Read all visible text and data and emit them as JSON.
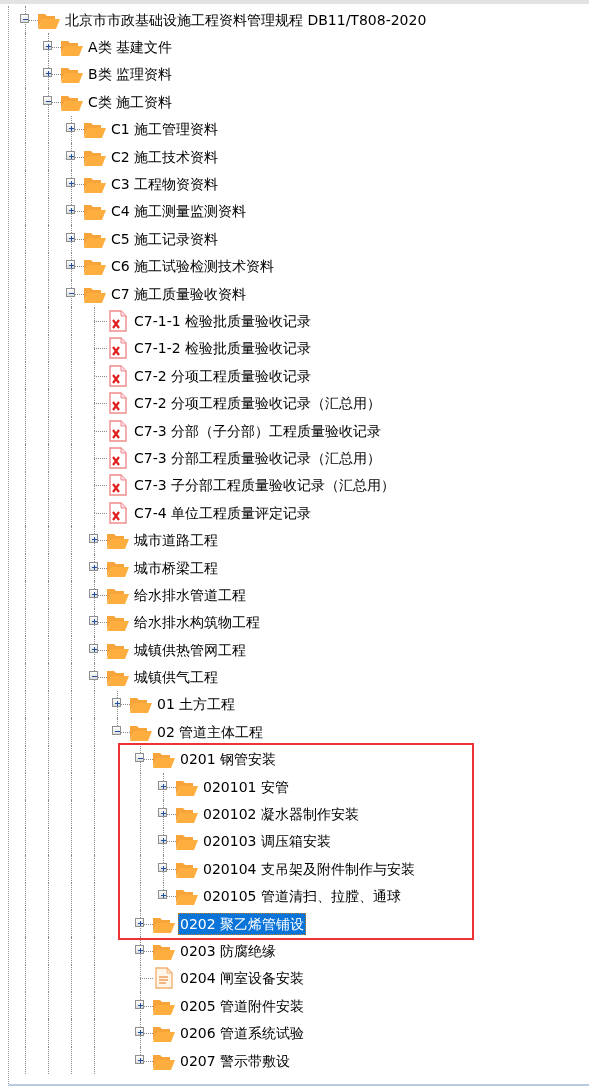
{
  "tree": [
    {
      "kind": "folder",
      "label": "北京市市政基础设施工程资料管理规程 DB11/T808-2020",
      "expanded": true,
      "selected": false,
      "children": [
        {
          "kind": "folder",
          "label": "A类 基建文件",
          "expanded": false,
          "selected": false
        },
        {
          "kind": "folder",
          "label": "B类 监理资料",
          "expanded": false,
          "selected": false
        },
        {
          "kind": "folder",
          "label": "C类 施工资料",
          "expanded": true,
          "selected": false,
          "children": [
            {
              "kind": "folder",
              "label": "C1 施工管理资料",
              "expanded": false,
              "selected": false
            },
            {
              "kind": "folder",
              "label": "C2 施工技术资料",
              "expanded": false,
              "selected": false
            },
            {
              "kind": "folder",
              "label": "C3 工程物资资料",
              "expanded": false,
              "selected": false
            },
            {
              "kind": "folder",
              "label": "C4 施工测量监测资料",
              "expanded": false,
              "selected": false
            },
            {
              "kind": "folder",
              "label": "C5 施工记录资料",
              "expanded": false,
              "selected": false
            },
            {
              "kind": "folder",
              "label": "C6 施工试验检测技术资料",
              "expanded": false,
              "selected": false
            },
            {
              "kind": "folder",
              "label": "C7 施工质量验收资料",
              "expanded": true,
              "selected": false,
              "children": [
                {
                  "kind": "pdf",
                  "label": "C7-1-1 检验批质量验收记录",
                  "selected": false
                },
                {
                  "kind": "pdf",
                  "label": "C7-1-2 检验批质量验收记录",
                  "selected": false
                },
                {
                  "kind": "pdf",
                  "label": "C7-2 分项工程质量验收记录",
                  "selected": false
                },
                {
                  "kind": "pdf",
                  "label": "C7-2 分项工程质量验收记录（汇总用）",
                  "selected": false
                },
                {
                  "kind": "pdf",
                  "label": "C7-3 分部（子分部）工程质量验收记录",
                  "selected": false
                },
                {
                  "kind": "pdf",
                  "label": "C7-3 分部工程质量验收记录（汇总用）",
                  "selected": false
                },
                {
                  "kind": "pdf",
                  "label": "C7-3 子分部工程质量验收记录（汇总用）",
                  "selected": false
                },
                {
                  "kind": "pdf",
                  "label": "C7-4 单位工程质量评定记录",
                  "selected": false
                },
                {
                  "kind": "folder",
                  "label": "城市道路工程",
                  "expanded": false,
                  "selected": false
                },
                {
                  "kind": "folder",
                  "label": "城市桥梁工程",
                  "expanded": false,
                  "selected": false
                },
                {
                  "kind": "folder",
                  "label": "给水排水管道工程",
                  "expanded": false,
                  "selected": false
                },
                {
                  "kind": "folder",
                  "label": "给水排水构筑物工程",
                  "expanded": false,
                  "selected": false
                },
                {
                  "kind": "folder",
                  "label": "城镇供热管网工程",
                  "expanded": false,
                  "selected": false
                },
                {
                  "kind": "folder",
                  "label": "城镇供气工程",
                  "expanded": true,
                  "selected": false,
                  "children": [
                    {
                      "kind": "folder",
                      "label": "01 土方工程",
                      "expanded": false,
                      "selected": false
                    },
                    {
                      "kind": "folder",
                      "label": "02 管道主体工程",
                      "expanded": true,
                      "selected": false,
                      "children": [
                        {
                          "kind": "folder",
                          "label": "0201 钢管安装",
                          "expanded": true,
                          "selected": false,
                          "highlighted": true,
                          "children": [
                            {
                              "kind": "folder",
                              "label": "020101 安管",
                              "expanded": false,
                              "selected": false
                            },
                            {
                              "kind": "folder",
                              "label": "020102 凝水器制作安装",
                              "expanded": false,
                              "selected": false
                            },
                            {
                              "kind": "folder",
                              "label": "020103 调压箱安装",
                              "expanded": false,
                              "selected": false
                            },
                            {
                              "kind": "folder",
                              "label": "020104 支吊架及附件制作与安装",
                              "expanded": false,
                              "selected": false
                            },
                            {
                              "kind": "folder",
                              "label": "020105 管道清扫、拉膛、通球",
                              "expanded": false,
                              "selected": false
                            }
                          ]
                        },
                        {
                          "kind": "folder",
                          "label": "0202 聚乙烯管铺设",
                          "expanded": false,
                          "selected": true,
                          "highlighted": true
                        },
                        {
                          "kind": "folder",
                          "label": "0203 防腐绝缘",
                          "expanded": false,
                          "selected": false
                        },
                        {
                          "kind": "doc",
                          "label": "0204 闸室设备安装",
                          "selected": false
                        },
                        {
                          "kind": "folder",
                          "label": "0205 管道附件安装",
                          "expanded": false,
                          "selected": false
                        },
                        {
                          "kind": "folder",
                          "label": "0206 管道系统试验",
                          "expanded": false,
                          "selected": false
                        },
                        {
                          "kind": "folder",
                          "label": "0207 警示带敷设",
                          "expanded": false,
                          "selected": false
                        }
                      ]
                    }
                  ]
                }
              ]
            }
          ]
        }
      ]
    }
  ]
}
